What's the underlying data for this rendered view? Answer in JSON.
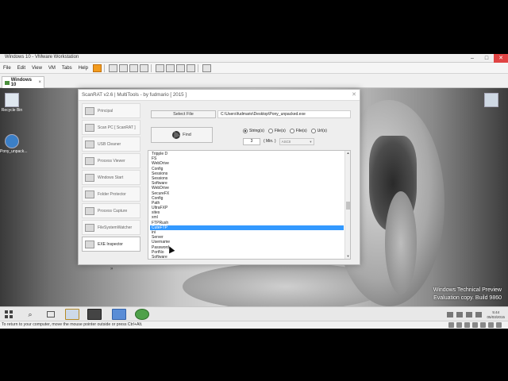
{
  "vmware": {
    "title": "Windows 10 - VMware Workstation",
    "menu": [
      "File",
      "Edit",
      "View",
      "VM",
      "Tabs",
      "Help"
    ],
    "tab_label": "Windows 10",
    "tab_close": "×",
    "window_buttons": [
      "–",
      "□",
      "✕"
    ]
  },
  "desktop": {
    "icons": [
      {
        "label": "Recycle Bin",
        "icon": "recycle-bin-icon"
      },
      {
        "label": "Pony_unpack...",
        "icon": "executable-icon"
      }
    ],
    "watermark": [
      "Windows Technical Preview",
      "Evaluation copy. Build 9860"
    ]
  },
  "app": {
    "title": "ScanRAT v2.6 | MultiTools - by fudmario [ 2015 ]",
    "close": "✕",
    "sidebar": [
      {
        "label": "Principal",
        "icon": "home-icon",
        "active": false
      },
      {
        "label": "Scan PC [ ScanRAT ]",
        "icon": "scan-icon",
        "active": false
      },
      {
        "label": "USB Cleaner",
        "icon": "usb-icon",
        "active": false
      },
      {
        "label": "Process Viewer",
        "icon": "process-icon",
        "active": false
      },
      {
        "label": "Windows Start",
        "icon": "windows-start-icon",
        "active": false
      },
      {
        "label": "Folder Protector",
        "icon": "folder-lock-icon",
        "active": false
      },
      {
        "label": "Process Capture",
        "icon": "capture-icon",
        "active": false
      },
      {
        "label": "FileSystemWatcher",
        "icon": "watcher-icon",
        "active": false
      },
      {
        "label": "EXE Inspector",
        "icon": "exe-icon",
        "active": true
      }
    ],
    "sidebar_arrow": "»",
    "select_file_label": "Select File",
    "file_path": "C:\\Users\\fudmario\\Desktop\\Pony_unpacked.exe",
    "find_label": "Find",
    "options": [
      {
        "label": "String(s)",
        "checked": true
      },
      {
        "label": "File(s)",
        "checked": false
      },
      {
        "label": "File(s)",
        "checked": false
      },
      {
        "label": "Url(s)",
        "checked": false
      }
    ],
    "min_value": "3",
    "min_label": "( Min. )",
    "encoding": "ASCII",
    "results": [
      "Tripple D",
      "FS",
      "WebDrive",
      "Config",
      "Sessions",
      "Sessions",
      "Software",
      "WebDrive",
      "SecureFX",
      "Config",
      "Path",
      "UltraFXP",
      "sites",
      "xml",
      "FTPRush",
      "CuteFTP",
      "ini",
      "Server",
      "Username",
      "Password",
      "PortNo",
      "Software"
    ],
    "selected_index": 15
  },
  "statusbar": {
    "text": "To return to your computer, move the mouse pointer outside or press Ctrl+Alt."
  },
  "taskbar": {
    "search_icon": "⌕",
    "clock_time": "5:44",
    "clock_date": "05/03/2015"
  }
}
